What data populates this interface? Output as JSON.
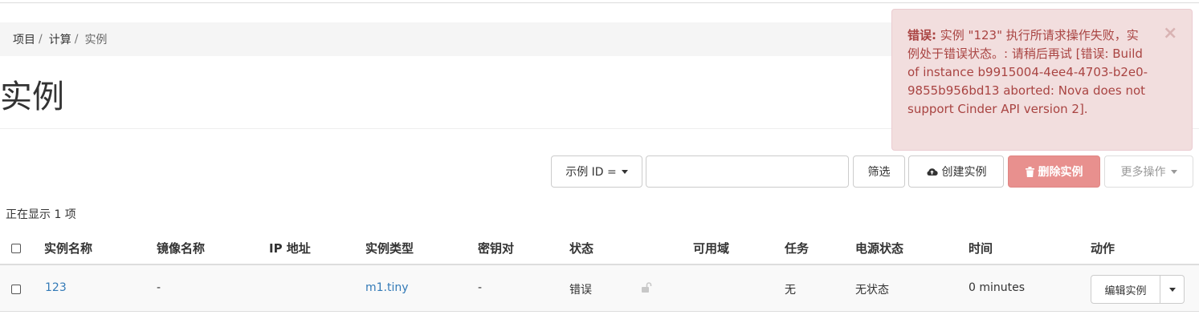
{
  "breadcrumb": {
    "item1": "项目",
    "item2": "计算",
    "current": "实例",
    "separator": "/"
  },
  "page": {
    "title": "实例"
  },
  "toolbar": {
    "filter_field": "示例 ID =",
    "filter_input_value": "",
    "filter_button": "筛选",
    "create_button": "创建实例",
    "delete_button": "删除实例",
    "more_button": "更多操作"
  },
  "count_text": "正在显示 1 项",
  "table": {
    "headers": {
      "name": "实例名称",
      "image": "镜像名称",
      "ip": "IP 地址",
      "flavor": "实例类型",
      "keypair": "密钥对",
      "status": "状态",
      "az": "可用域",
      "task": "任务",
      "power": "电源状态",
      "time": "时间",
      "actions": "动作"
    },
    "rows": [
      {
        "name": "123",
        "image": "-",
        "ip": "",
        "flavor": "m1.tiny",
        "keypair": "-",
        "status": "错误",
        "az": "",
        "task": "无",
        "power": "无状态",
        "time": "0 minutes",
        "action": "编辑实例"
      }
    ]
  },
  "alert": {
    "heading": "错误:",
    "message": "实例 \"123\" 执行所请求操作失败，实例处于错误状态。: 请稍后再试 [错误: Build of instance b9915004-4ee4-4703-b2e0-9855b956bd13 aborted: Nova does not support Cinder API version 2].",
    "close": "×"
  },
  "colors": {
    "link": "#337ab7",
    "danger": "#e8908e",
    "alert_bg": "#f2dede",
    "alert_text": "#a94442"
  }
}
